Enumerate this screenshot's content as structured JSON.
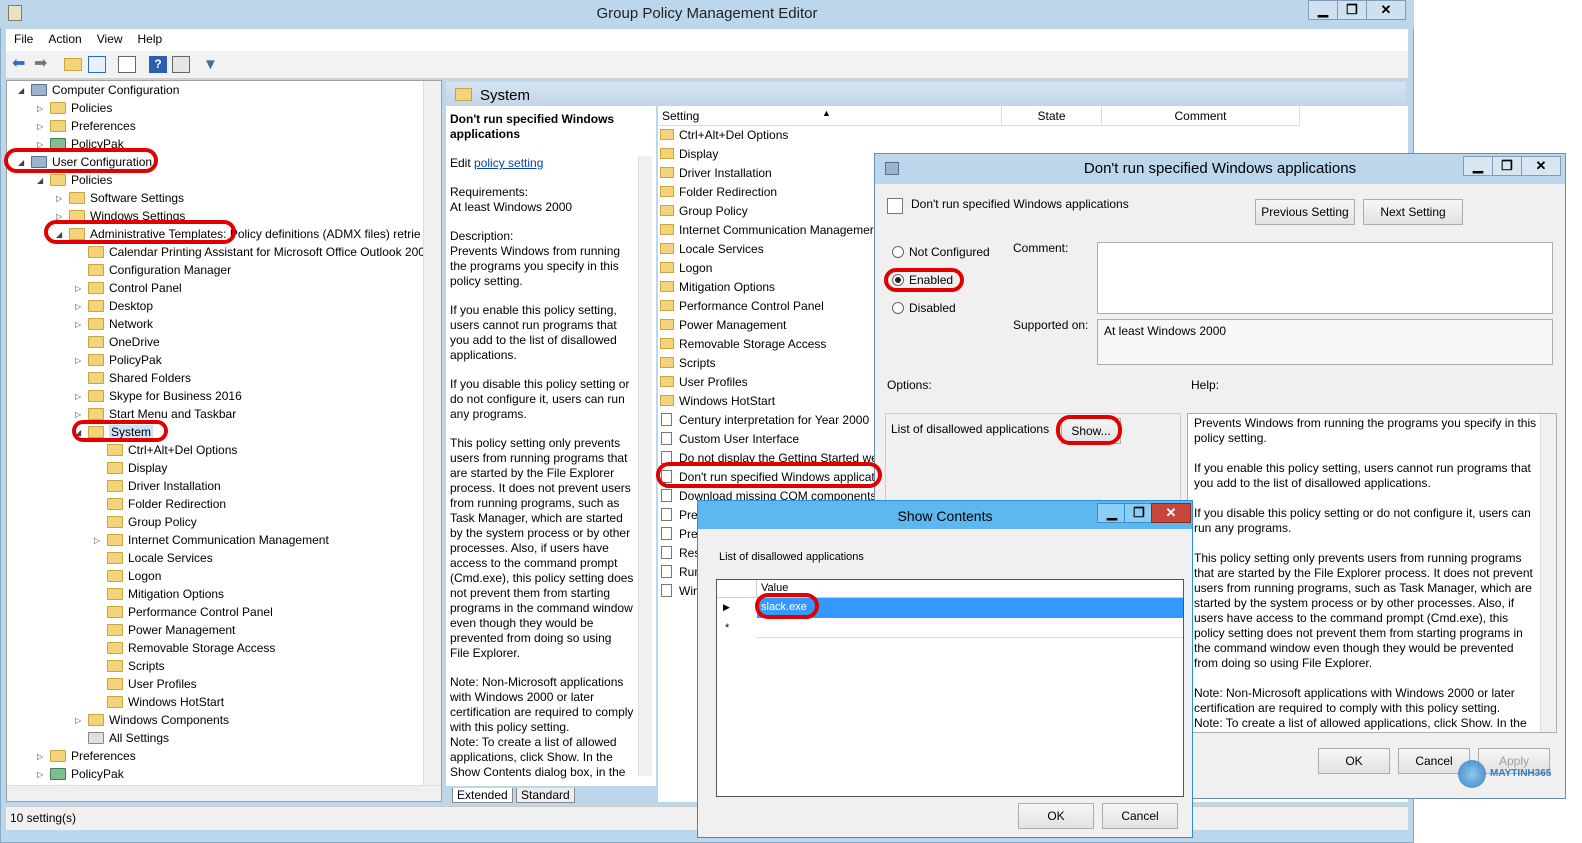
{
  "window": {
    "title": "Group Policy Management Editor",
    "min": "▁",
    "max": "❐",
    "close": "✕"
  },
  "menu": [
    "File",
    "Action",
    "View",
    "Help"
  ],
  "tree": {
    "computer_configuration": "Computer Configuration",
    "policies": "Policies",
    "preferences": "Preferences",
    "policypak": "PolicyPak",
    "user_configuration": "User Configuration",
    "user_policies": "Policies",
    "software_settings": "Software Settings",
    "windows_settings": "Windows Settings",
    "admin_templates": "Administrative Templates: Policy definitions (ADMX files) retrie",
    "calendar": "Calendar Printing Assistant for Microsoft Office Outlook 200",
    "config_manager": "Configuration Manager",
    "control_panel": "Control Panel",
    "desktop": "Desktop",
    "network": "Network",
    "onedrive": "OneDrive",
    "policypak2": "PolicyPak",
    "shared_folders": "Shared Folders",
    "skype": "Skype for Business 2016",
    "start_menu": "Start Menu and Taskbar",
    "system": "System",
    "system_children": [
      "Ctrl+Alt+Del Options",
      "Display",
      "Driver Installation",
      "Folder Redirection",
      "Group Policy",
      "Internet Communication Management",
      "Locale Services",
      "Logon",
      "Mitigation Options",
      "Performance Control Panel",
      "Power Management",
      "Removable Storage Access",
      "Scripts",
      "User Profiles",
      "Windows HotStart"
    ],
    "windows_components": "Windows Components",
    "all_settings": "All Settings",
    "user_preferences": "Preferences",
    "user_policypak": "PolicyPak"
  },
  "header": {
    "section": "System"
  },
  "description": {
    "title": "Don't run specified Windows applications",
    "edit_prefix": "Edit",
    "edit_link": "policy setting",
    "requirements": "Requirements:\nAt least Windows 2000",
    "p1": "Description:\nPrevents Windows from running the programs you specify in this policy setting.",
    "p2": "If you enable this policy setting, users cannot run programs that you add to the list of disallowed applications.",
    "p3": "If you disable this policy setting or do not configure it, users can run any programs.",
    "p4": "This policy setting only prevents users from running programs that are started by the File Explorer process. It does not prevent users from running programs, such as Task Manager, which are started by the system process or by other processes.  Also, if users have access to the command prompt (Cmd.exe), this policy setting does not prevent them from starting programs in the command window even though they would be prevented from doing so using File Explorer.",
    "p5": "Note: Non-Microsoft applications with Windows 2000 or later certification are required to comply with this policy setting.\nNote: To create a list of allowed applications, click Show.  In the Show Contents dialog box, in the"
  },
  "list": {
    "columns": [
      "Setting",
      "State",
      "Comment"
    ],
    "folders": [
      "Ctrl+Alt+Del Options",
      "Display",
      "Driver Installation",
      "Folder Redirection",
      "Group Policy",
      "Internet Communication Managemer",
      "Locale Services",
      "Logon",
      "Mitigation Options",
      "Performance Control Panel",
      "Power Management",
      "Removable Storage Access",
      "Scripts",
      "User Profiles",
      "Windows HotStart"
    ],
    "settings": [
      "Century interpretation for Year 2000",
      "Custom User Interface",
      "Do not display the Getting Started wel",
      "Don't run specified Windows applicati",
      "Download missing COM components",
      "Prev",
      "Prev",
      "Rest",
      "Run",
      "Win"
    ]
  },
  "tabs": [
    "Extended",
    "Standard"
  ],
  "status": "10 setting(s)",
  "policy_dialog": {
    "title": "Don't run specified Windows applications",
    "subtitle": "Don't run specified Windows applications",
    "prev": "Previous Setting",
    "next": "Next Setting",
    "not_configured": "Not Configured",
    "enabled": "Enabled",
    "disabled": "Disabled",
    "comment_label": "Comment:",
    "supported_label": "Supported on:",
    "supported_value": "At least Windows 2000",
    "options_label": "Options:",
    "help_label": "Help:",
    "list_label": "List of disallowed applications",
    "show": "Show...",
    "help_text": "Prevents Windows from running the programs you specify in this policy setting.\n\nIf you enable this policy setting, users cannot run programs that you add to the list of disallowed applications.\n\nIf you disable this policy setting or do not configure it, users can run any programs.\n\nThis policy setting only prevents users from running programs that are started by the File Explorer process. It does not prevent users from running programs, such as Task Manager, which are started by the system process or by other processes.  Also, if users have access to the command prompt (Cmd.exe), this policy setting does not prevent them from starting programs in the command window even though they would be prevented from doing so using File Explorer.\n\nNote: Non-Microsoft applications with Windows 2000 or later certification are required to comply with this policy setting.\nNote: To create a list of allowed applications, click Show.  In the",
    "ok": "OK",
    "cancel": "Cancel",
    "apply": "Apply"
  },
  "show_contents": {
    "title": "Show Contents",
    "label": "List of disallowed applications",
    "col": "Value",
    "value": "slack.exe",
    "new_row": "*",
    "ok": "OK",
    "cancel": "Cancel"
  },
  "watermark": {
    "brand": "MAYTINH365"
  }
}
